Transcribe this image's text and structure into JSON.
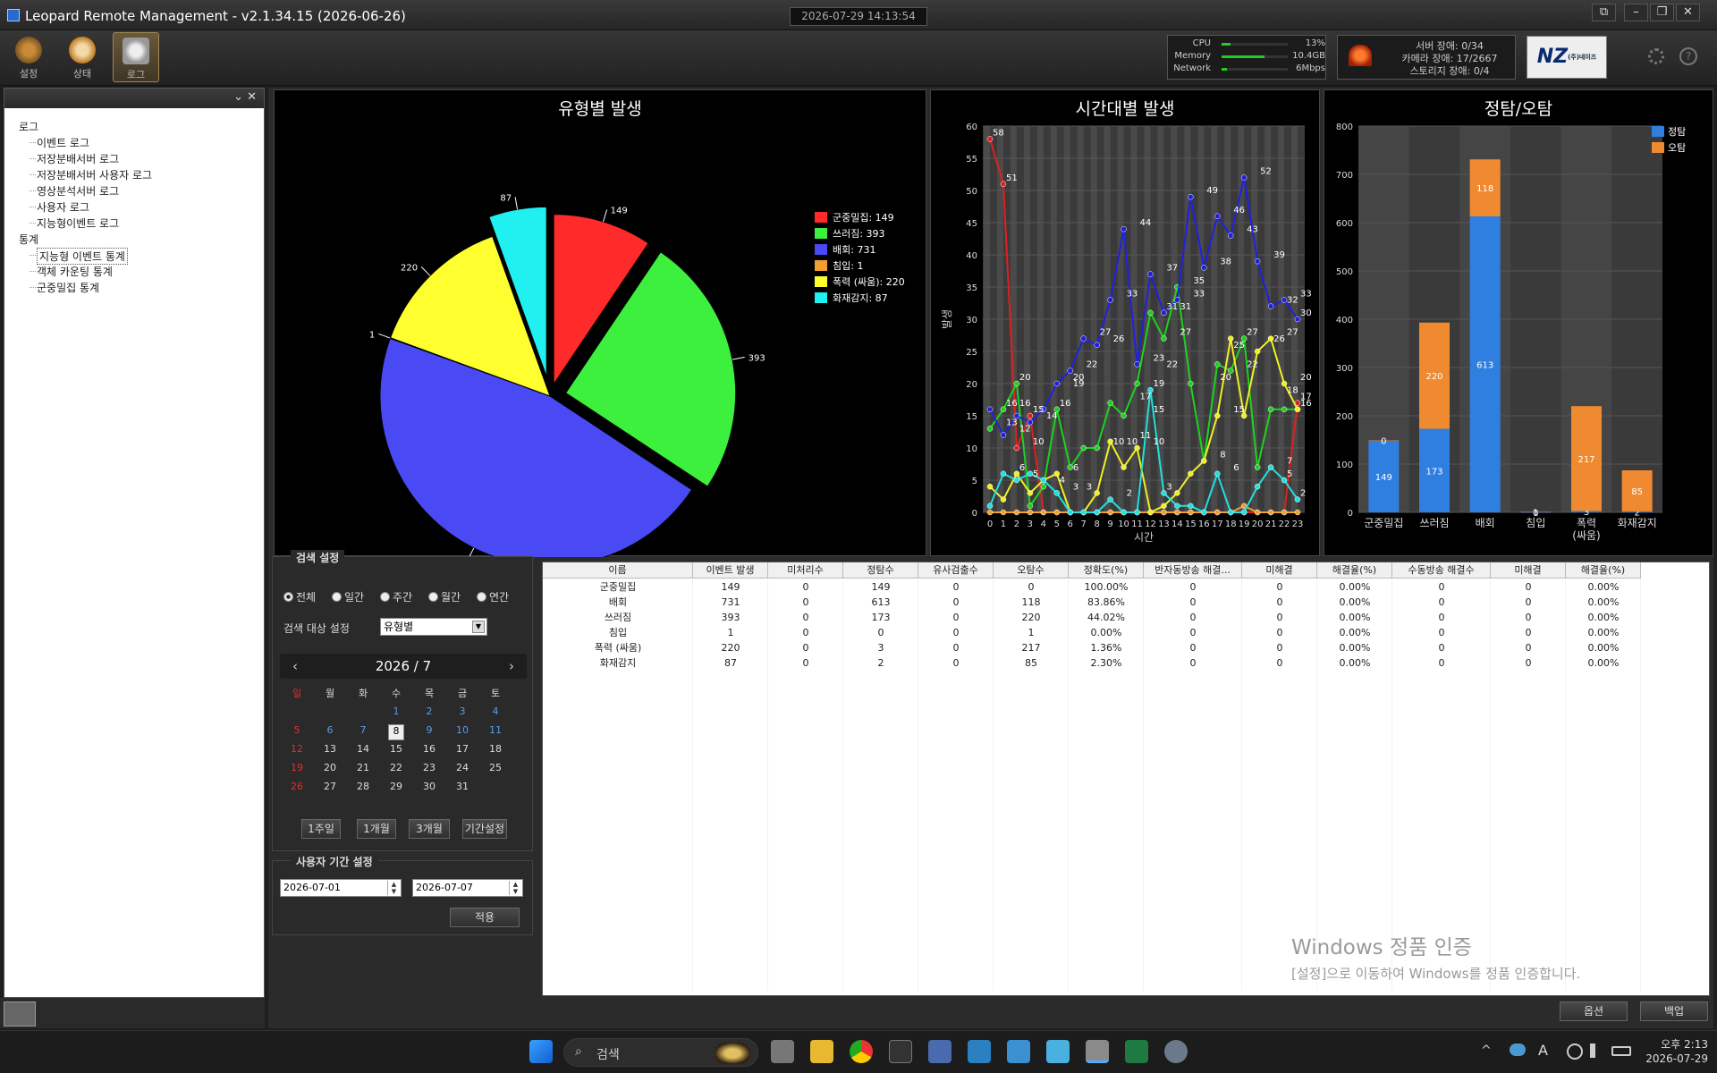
{
  "window": {
    "title": "Leopard Remote Management - v2.1.34.15 (2026-06-26)",
    "clock": "2026-07-29 14:13:54",
    "controls": [
      "⧉",
      "–",
      "❐",
      "✕"
    ]
  },
  "toolbar": {
    "items": [
      {
        "label": "설정",
        "icon": "settings-icon"
      },
      {
        "label": "상태",
        "icon": "clock-icon"
      },
      {
        "label": "로그",
        "icon": "search-icon",
        "active": true
      }
    ]
  },
  "system": {
    "cpu": {
      "label": "CPU",
      "value": "13%",
      "level": 0.13
    },
    "memory": {
      "label": "Memory",
      "value": "10.4GB",
      "level": 0.65
    },
    "network": {
      "label": "Network",
      "value": "6Mbps",
      "level": 0.08
    }
  },
  "alarms": {
    "server": "서버 장애: 0/34",
    "camera": "카메라 장애: 17/2667",
    "storage": "스토리지 장애: 0/4"
  },
  "logo": {
    "text": "NZ",
    "sub": "(주)네이즈"
  },
  "sidebar": {
    "close": "⌄  ✕",
    "tree": [
      {
        "label": "로그",
        "level": 0
      },
      {
        "label": "이벤트 로그",
        "level": 1
      },
      {
        "label": "저장분배서버 로그",
        "level": 1
      },
      {
        "label": "저장분배서버 사용자 로그",
        "level": 1
      },
      {
        "label": "영상분석서버 로그",
        "level": 1
      },
      {
        "label": "사용자 로그",
        "level": 1
      },
      {
        "label": "지능형이벤트 로그",
        "level": 1
      },
      {
        "label": "통계",
        "level": 0
      },
      {
        "label": "지능형 이벤트 통계",
        "level": 1,
        "selected": true
      },
      {
        "label": "객체 카운팅 통계",
        "level": 1
      },
      {
        "label": "군중밀집 통계",
        "level": 1
      }
    ]
  },
  "chart_data": [
    {
      "type": "pie",
      "title": "유형별 발생",
      "categories": [
        "군중밀집",
        "쓰러짐",
        "배회",
        "침입",
        "폭력 (싸움)",
        "화재감지"
      ],
      "values": [
        149,
        393,
        731,
        1,
        220,
        87
      ],
      "legend": [
        "군중밀집: 149",
        "쓰러짐: 393",
        "배회: 731",
        "침입: 1",
        "폭력 (싸움): 220",
        "화재감지: 87"
      ],
      "colors": [
        "#ff2a2a",
        "#3ef03e",
        "#4a4af5",
        "#f0a030",
        "#ffff30",
        "#20f0f0"
      ],
      "legend_position": "top-right"
    },
    {
      "type": "line",
      "title": "시간대별 발생",
      "xlabel": "시간",
      "ylabel": "발생",
      "x": [
        0,
        1,
        2,
        3,
        4,
        5,
        6,
        7,
        8,
        9,
        10,
        11,
        12,
        13,
        14,
        15,
        16,
        17,
        18,
        19,
        20,
        21,
        22,
        23
      ],
      "ylim": [
        0,
        60
      ],
      "yticks": [
        0,
        5,
        10,
        15,
        20,
        25,
        30,
        35,
        40,
        45,
        50,
        55,
        60
      ],
      "series": [
        {
          "name": "군중밀집",
          "color": "#e02020",
          "values": [
            58,
            51,
            10,
            15,
            0,
            0,
            0,
            0,
            0,
            0,
            0,
            0,
            0,
            0,
            0,
            0,
            0,
            0,
            0,
            0,
            0,
            0,
            0,
            17
          ]
        },
        {
          "name": "쓰러짐",
          "color": "#20d020",
          "values": [
            13,
            16,
            20,
            1,
            4,
            16,
            7,
            10,
            10,
            17,
            15,
            20,
            31,
            27,
            35,
            20,
            8,
            23,
            22,
            27,
            7,
            16,
            16,
            16
          ]
        },
        {
          "name": "배회",
          "color": "#2020e0",
          "values": [
            16,
            12,
            15,
            14,
            16,
            20,
            22,
            27,
            26,
            33,
            44,
            23,
            37,
            31,
            33,
            49,
            38,
            46,
            43,
            52,
            39,
            32,
            33,
            30
          ]
        },
        {
          "name": "침입",
          "color": "#f0a030",
          "values": [
            0,
            0,
            0,
            0,
            0,
            0,
            0,
            0,
            0,
            0,
            0,
            0,
            0,
            0,
            0,
            0,
            0,
            0,
            0,
            1,
            0,
            0,
            0,
            0
          ]
        },
        {
          "name": "폭력 (싸움)",
          "color": "#f0f020",
          "values": [
            4,
            2,
            6,
            3,
            5,
            6,
            0,
            0,
            3,
            11,
            7,
            10,
            0,
            1,
            3,
            6,
            8,
            15,
            27,
            15,
            25,
            27,
            20,
            16
          ]
        },
        {
          "name": "화재감지",
          "color": "#20e0e0",
          "values": [
            1,
            6,
            5,
            6,
            5,
            3,
            0,
            0,
            0,
            2,
            0,
            0,
            19,
            3,
            1,
            1,
            0,
            6,
            0,
            0,
            4,
            7,
            5,
            2
          ]
        }
      ],
      "labels": [
        {
          "x": 0,
          "y": 58,
          "t": "58"
        },
        {
          "x": 1,
          "y": 51,
          "t": "51"
        },
        {
          "x": 2,
          "y": 20,
          "t": "20"
        },
        {
          "x": 3,
          "y": 15,
          "t": "15"
        },
        {
          "x": 2,
          "y": 16,
          "t": "16"
        },
        {
          "x": 1,
          "y": 16,
          "t": "16"
        },
        {
          "x": 1,
          "y": 13,
          "t": "13"
        },
        {
          "x": 2,
          "y": 12,
          "t": "12"
        },
        {
          "x": 3,
          "y": 10,
          "t": "10"
        },
        {
          "x": 4,
          "y": 14,
          "t": "14"
        },
        {
          "x": 5,
          "y": 16,
          "t": "16"
        },
        {
          "x": 6,
          "y": 19,
          "t": "19"
        },
        {
          "x": 6,
          "y": 20,
          "t": "20"
        },
        {
          "x": 7,
          "y": 22,
          "t": "22"
        },
        {
          "x": 8,
          "y": 27,
          "t": "27"
        },
        {
          "x": 9,
          "y": 26,
          "t": "26"
        },
        {
          "x": 10,
          "y": 33,
          "t": "33"
        },
        {
          "x": 11,
          "y": 44,
          "t": "44"
        },
        {
          "x": 12,
          "y": 23,
          "t": "23"
        },
        {
          "x": 13,
          "y": 37,
          "t": "37"
        },
        {
          "x": 13,
          "y": 31,
          "t": "31"
        },
        {
          "x": 14,
          "y": 31,
          "t": "31"
        },
        {
          "x": 13,
          "y": 22,
          "t": "22"
        },
        {
          "x": 14,
          "y": 27,
          "t": "27"
        },
        {
          "x": 15,
          "y": 35,
          "t": "35"
        },
        {
          "x": 15,
          "y": 33,
          "t": "33"
        },
        {
          "x": 16,
          "y": 49,
          "t": "49"
        },
        {
          "x": 17,
          "y": 38,
          "t": "38"
        },
        {
          "x": 18,
          "y": 46,
          "t": "46"
        },
        {
          "x": 19,
          "y": 43,
          "t": "43"
        },
        {
          "x": 20,
          "y": 52,
          "t": "52"
        },
        {
          "x": 21,
          "y": 39,
          "t": "39"
        },
        {
          "x": 22,
          "y": 32,
          "t": "32"
        },
        {
          "x": 23,
          "y": 33,
          "t": "33"
        },
        {
          "x": 23,
          "y": 30,
          "t": "30"
        },
        {
          "x": 19,
          "y": 27,
          "t": "27"
        },
        {
          "x": 22,
          "y": 27,
          "t": "27"
        },
        {
          "x": 21,
          "y": 26,
          "t": "26"
        },
        {
          "x": 18,
          "y": 25,
          "t": "25"
        },
        {
          "x": 19,
          "y": 22,
          "t": "22"
        },
        {
          "x": 23,
          "y": 20,
          "t": "20"
        },
        {
          "x": 17,
          "y": 20,
          "t": "20"
        },
        {
          "x": 12,
          "y": 19,
          "t": "19"
        },
        {
          "x": 11,
          "y": 17,
          "t": "17"
        },
        {
          "x": 12,
          "y": 15,
          "t": "15"
        },
        {
          "x": 18,
          "y": 15,
          "t": "15"
        },
        {
          "x": 22,
          "y": 18,
          "t": "18"
        },
        {
          "x": 23,
          "y": 17,
          "t": "17"
        },
        {
          "x": 23,
          "y": 16,
          "t": "16"
        },
        {
          "x": 11,
          "y": 11,
          "t": "11"
        },
        {
          "x": 9,
          "y": 10,
          "t": "10"
        },
        {
          "x": 10,
          "y": 10,
          "t": "10"
        },
        {
          "x": 12,
          "y": 10,
          "t": "10"
        },
        {
          "x": 17,
          "y": 8,
          "t": "8"
        },
        {
          "x": 18,
          "y": 6,
          "t": "6"
        },
        {
          "x": 22,
          "y": 7,
          "t": "7"
        },
        {
          "x": 6,
          "y": 6,
          "t": "6"
        },
        {
          "x": 2,
          "y": 6,
          "t": "6"
        },
        {
          "x": 3,
          "y": 5,
          "t": "5"
        },
        {
          "x": 5,
          "y": 4,
          "t": "4"
        },
        {
          "x": 6,
          "y": 3,
          "t": "3"
        },
        {
          "x": 7,
          "y": 3,
          "t": "3"
        },
        {
          "x": 13,
          "y": 3,
          "t": "3"
        },
        {
          "x": 22,
          "y": 5,
          "t": "5"
        },
        {
          "x": 23,
          "y": 2,
          "t": "2"
        },
        {
          "x": 10,
          "y": 2,
          "t": "2"
        }
      ]
    },
    {
      "type": "bar",
      "title": "정탐/오탐",
      "categories": [
        "군중밀집",
        "쓰러짐",
        "배회",
        "침입",
        "폭력\n(싸움)",
        "화재감지"
      ],
      "ylim": [
        0,
        800
      ],
      "yticks": [
        0,
        100,
        200,
        300,
        400,
        500,
        600,
        700,
        800
      ],
      "stacked": true,
      "series": [
        {
          "name": "정탐",
          "color": "#2f7fe0",
          "values": [
            149,
            173,
            613,
            0,
            3,
            2
          ]
        },
        {
          "name": "오탐",
          "color": "#f08a30",
          "values": [
            0,
            220,
            118,
            1,
            217,
            85
          ]
        }
      ],
      "legend_position": "top-right"
    }
  ],
  "search": {
    "title": "검색 설정",
    "periods": [
      {
        "label": "전체",
        "checked": true
      },
      {
        "label": "일간",
        "checked": false
      },
      {
        "label": "주간",
        "checked": false
      },
      {
        "label": "월간",
        "checked": false
      },
      {
        "label": "연간",
        "checked": false
      }
    ],
    "target_label": "검색 대상 설정",
    "target_value": "유형별",
    "calendar": {
      "header": "2026 / 7",
      "weekdays": [
        "일",
        "월",
        "화",
        "수",
        "목",
        "금",
        "토"
      ],
      "weeks": [
        [
          "",
          "",
          "",
          "1",
          "2",
          "3",
          "4"
        ],
        [
          "5",
          "6",
          "7",
          "8",
          "9",
          "10",
          "11"
        ],
        [
          "12",
          "13",
          "14",
          "15",
          "16",
          "17",
          "18"
        ],
        [
          "19",
          "20",
          "21",
          "22",
          "23",
          "24",
          "25"
        ],
        [
          "26",
          "27",
          "28",
          "29",
          "30",
          "31",
          ""
        ]
      ],
      "today": "8"
    },
    "quick_buttons": [
      "1주일",
      "1개월",
      "3개월",
      "기간설정"
    ]
  },
  "period": {
    "title": "사용자 기간 설정",
    "start": "2026-07-01",
    "end": "2026-07-07",
    "apply": "적용"
  },
  "table": {
    "headers": [
      "이름",
      "이벤트 발생",
      "미처리수",
      "정탐수",
      "유사검출수",
      "오탐수",
      "정확도(%)",
      "반자동방송 해결...",
      "미해결",
      "해결율(%)",
      "수동방송 해결수",
      "미해결",
      "해결율(%)"
    ],
    "rows": [
      [
        "군중밀집",
        "149",
        "0",
        "149",
        "0",
        "0",
        "100.00%",
        "0",
        "0",
        "0.00%",
        "0",
        "0",
        "0.00%"
      ],
      [
        "배회",
        "731",
        "0",
        "613",
        "0",
        "118",
        "83.86%",
        "0",
        "0",
        "0.00%",
        "0",
        "0",
        "0.00%"
      ],
      [
        "쓰러짐",
        "393",
        "0",
        "173",
        "0",
        "220",
        "44.02%",
        "0",
        "0",
        "0.00%",
        "0",
        "0",
        "0.00%"
      ],
      [
        "침입",
        "1",
        "0",
        "0",
        "0",
        "1",
        "0.00%",
        "0",
        "0",
        "0.00%",
        "0",
        "0",
        "0.00%"
      ],
      [
        "폭력 (싸움)",
        "220",
        "0",
        "3",
        "0",
        "217",
        "1.36%",
        "0",
        "0",
        "0.00%",
        "0",
        "0",
        "0.00%"
      ],
      [
        "화재감지",
        "87",
        "0",
        "2",
        "0",
        "85",
        "2.30%",
        "0",
        "0",
        "0.00%",
        "0",
        "0",
        "0.00%"
      ]
    ]
  },
  "bottom_buttons": {
    "options": "옵션",
    "backup": "백업"
  },
  "watermark": {
    "title": "Windows 정품 인증",
    "sub": "[설정]으로 이동하여 Windows를 정품 인증합니다."
  },
  "taskbar": {
    "search": "검색",
    "time": "오후 2:13",
    "date": "2026-07-29",
    "ime": "A"
  }
}
